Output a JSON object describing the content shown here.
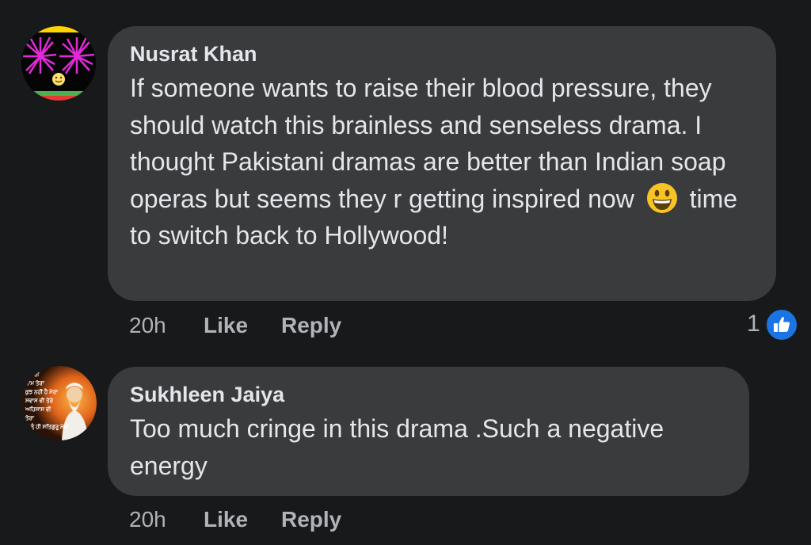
{
  "comments": [
    {
      "author": "Nusrat Khan",
      "text_before_emoji": "If someone wants to raise their blood pressure, they should watch this brainless and senseless drama. I thought Pakistani dramas are better than Indian soap operas but seems they r getting inspired now",
      "emoji": "grinning-face-emoji",
      "text_after_emoji": "time to switch back to Hollywood!",
      "time": "20h",
      "like_label": "Like",
      "reply_label": "Reply",
      "reaction_count": "1",
      "reaction_icon": "thumbs-up-icon",
      "avatar_icon": "fireworks-avatar-icon"
    },
    {
      "author": "Sukhleen Jaiya",
      "text": "Too much cringe in this drama .Such a negative energy",
      "time": "20h",
      "like_label": "Like",
      "reply_label": "Reply",
      "avatar_icon": "guru-portrait-avatar-icon",
      "avatar_text_lines": [
        "ਤੇ ਤੇਰੀ",
        "ਨਾਮ ਤੇਰਾ",
        "ਕੁਝ ਨਹੀਂ ਹੈ ਮੇਰਾ",
        "ਸਵਾਸ ਵੀ ਤੇਰੇ",
        "ਅਹਿਸਾਸ ਵੀ",
        "ਤੇਰਾ",
        "ਕੁੱ ਤੂੰ ਹੀ ਸਤਿਗੁਰੂ ਮੇਰਾ"
      ]
    }
  ],
  "colors": {
    "background": "#18191a",
    "bubble": "#3a3b3c",
    "text": "#e4e6eb",
    "secondary_text": "#b0b3b8",
    "like_blue": "#1b74e4"
  }
}
